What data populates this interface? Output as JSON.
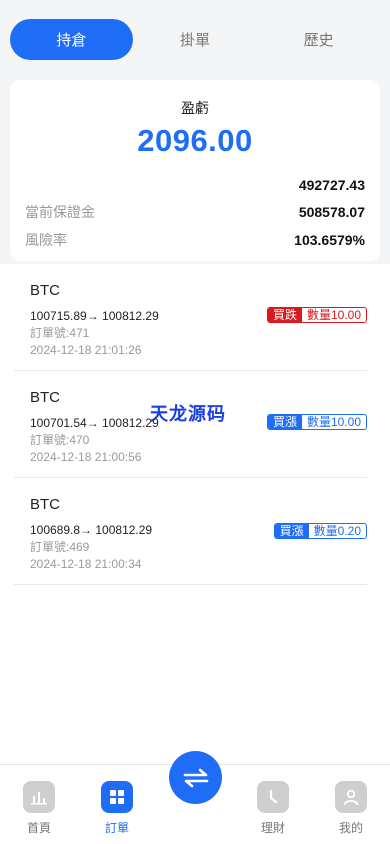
{
  "tabs": [
    {
      "label": "持倉",
      "active": true
    },
    {
      "label": "掛單",
      "active": false
    },
    {
      "label": "歷史",
      "active": false
    }
  ],
  "summary": {
    "pl_label": "盈虧",
    "pl_value": "2096.00",
    "balance_value": "492727.43",
    "margin_label": "當前保證金",
    "margin_value": "508578.07",
    "risk_label": "風險率",
    "risk_value": "103.6579%"
  },
  "orders": [
    {
      "symbol": "BTC",
      "price": "100715.89→ 100812.29",
      "order_no": "訂單號:471",
      "time": "2024-12-18 21:01:26",
      "side": "買跌",
      "qty": "數量10.00",
      "color": "#d71920"
    },
    {
      "symbol": "BTC",
      "price": "100701.54→ 100812.29",
      "order_no": "訂單號:470",
      "time": "2024-12-18 21:00:56",
      "side": "買漲",
      "qty": "數量10.00",
      "color": "#1f6df6"
    },
    {
      "symbol": "BTC",
      "price": "100689.8→ 100812.29",
      "order_no": "訂單號:469",
      "time": "2024-12-18 21:00:34",
      "side": "買漲",
      "qty": "數量0.20",
      "color": "#1f6df6"
    }
  ],
  "watermark": "天龙源码",
  "nav": {
    "home": "首頁",
    "orders": "訂單",
    "finance": "理財",
    "mine": "我的"
  },
  "colors": {
    "accent": "#1f6df6",
    "sell": "#d71920"
  }
}
